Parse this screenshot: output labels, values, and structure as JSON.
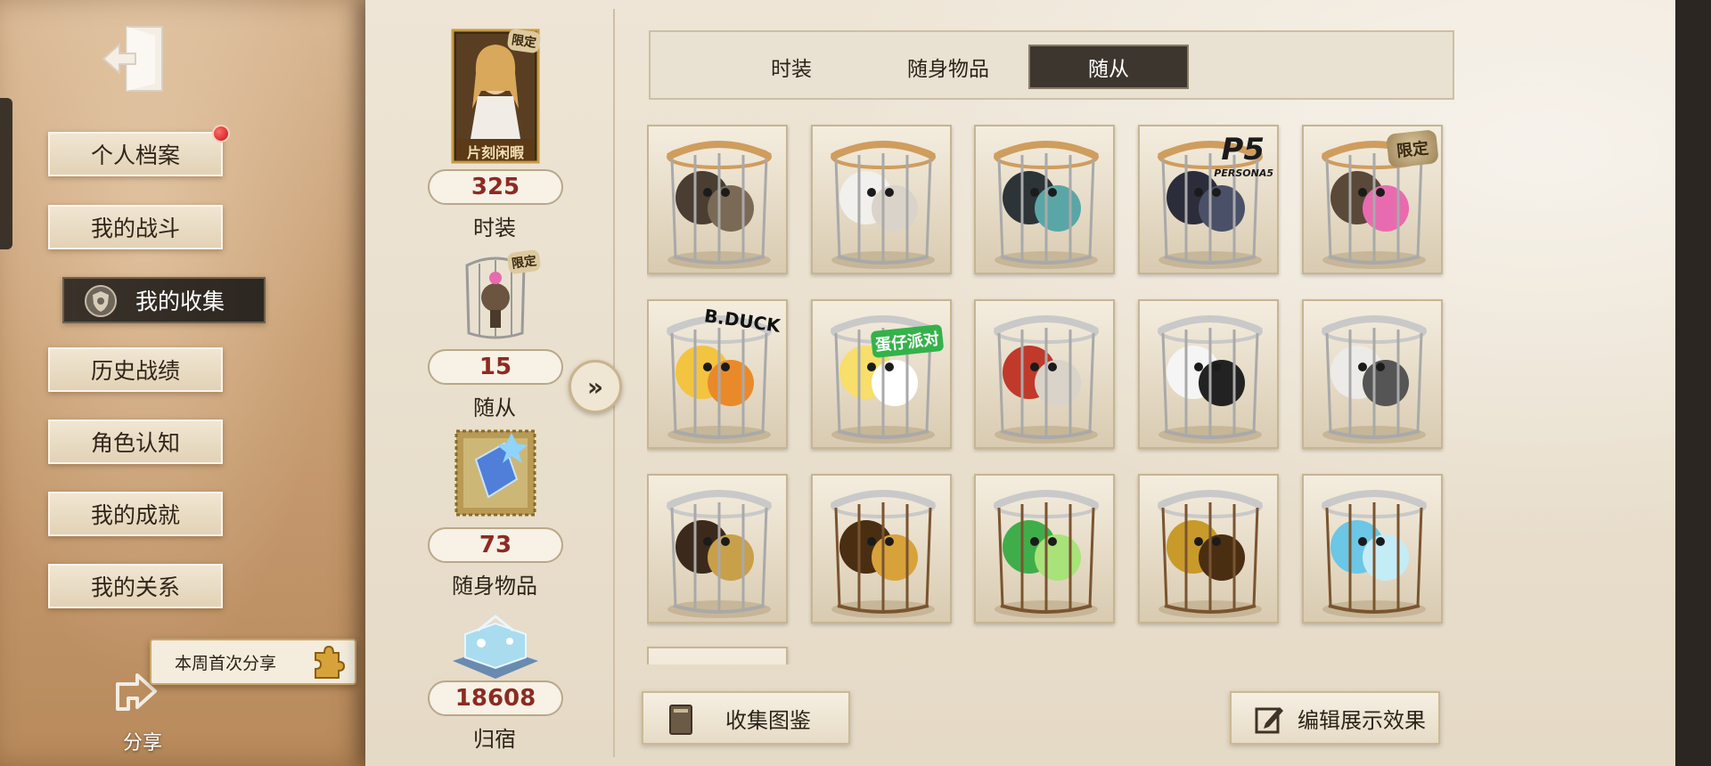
{
  "sidebar": {
    "items": [
      {
        "label": "个人档案",
        "has_notification": true
      },
      {
        "label": "我的战斗"
      },
      {
        "label": "我的收集",
        "active": true
      },
      {
        "label": "历史战绩"
      },
      {
        "label": "角色认知"
      },
      {
        "label": "我的成就"
      },
      {
        "label": "我的关系"
      }
    ],
    "share_tag": "本周首次分享",
    "share_label": "分享"
  },
  "stats": [
    {
      "badge": "片刻闲暇",
      "limited_label": "限定",
      "value": "325",
      "label": "时装"
    },
    {
      "limited_label": "限定",
      "value": "15",
      "label": "随从"
    },
    {
      "value": "73",
      "label": "随身物品"
    },
    {
      "value": "18608",
      "label": "归宿"
    }
  ],
  "tabs": [
    {
      "label": "时装"
    },
    {
      "label": "随身物品"
    },
    {
      "label": "随从",
      "active": true
    }
  ],
  "grid": {
    "rows": [
      [
        {
          "icon": "mechanical-robot-cage-icon"
        },
        {
          "icon": "white-dog-cage-icon"
        },
        {
          "icon": "antler-creature-cage-icon"
        },
        {
          "icon": "black-cat-mask-cage-icon",
          "badge": "P5",
          "badge_sub": "PERSONA5"
        },
        {
          "icon": "gear-robot-cage-icon",
          "badge": "限定"
        }
      ],
      [
        {
          "icon": "yellow-duck-cage-icon",
          "badge": "B.DUCK"
        },
        {
          "icon": "egg-character-cage-icon",
          "badge": "蛋仔派对"
        },
        {
          "icon": "cat-red-cape-cage-icon"
        },
        {
          "icon": "panda-cage-icon"
        },
        {
          "icon": "rabbit-cage-icon"
        }
      ],
      [
        {
          "icon": "accordion-cage-icon"
        },
        {
          "icon": "clock-cage-icon"
        },
        {
          "icon": "green-butterfly-cage-icon"
        },
        {
          "icon": "gramophone-cage-icon"
        },
        {
          "icon": "blue-butterfly-cage-icon"
        }
      ]
    ]
  },
  "buttons": {
    "catalog": "收集图鉴",
    "edit": "编辑展示效果"
  },
  "colors": {
    "count_red": "#8c2b22",
    "active_dark": "#3d362f",
    "parchment": "#eee5d6"
  }
}
